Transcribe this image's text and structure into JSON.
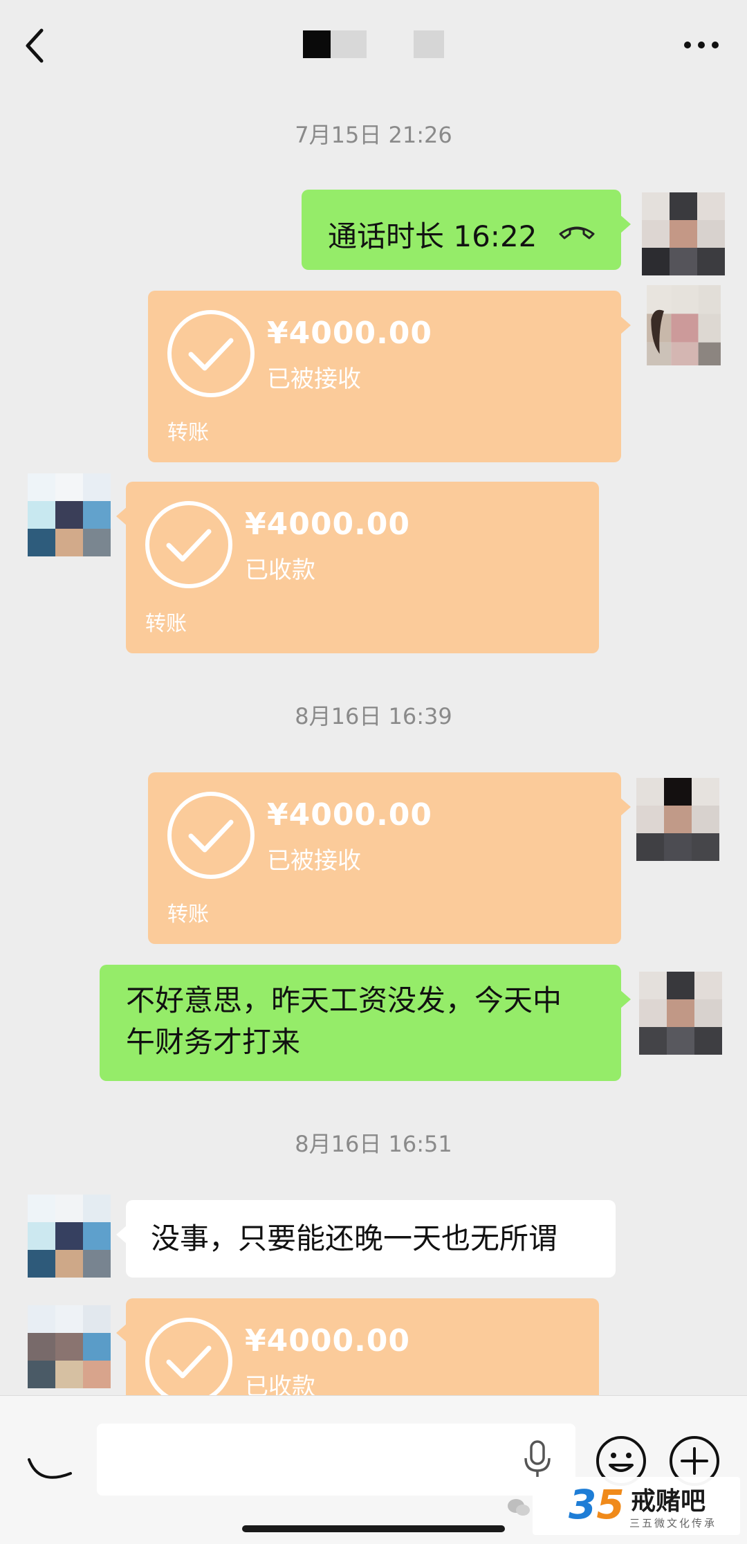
{
  "header": {
    "back_icon": "chevron-left-icon",
    "more_icon": "more-dots-icon"
  },
  "timestamps": [
    "7月15日 21:26",
    "8月16日 16:39",
    "8月16日 16:51"
  ],
  "messages": {
    "call": {
      "label": "通话时长 16:22",
      "icon": "phone-hangup-icon"
    },
    "transfer_1": {
      "amount": "¥4000.00",
      "status": "已被接收",
      "label": "转账"
    },
    "transfer_2": {
      "amount": "¥4000.00",
      "status": "已收款",
      "label": "转账"
    },
    "transfer_3": {
      "amount": "¥4000.00",
      "status": "已被接收",
      "label": "转账"
    },
    "text_1": {
      "line1": "不好意思，昨天工资没发，今天中",
      "line2": "午财务才打来"
    },
    "text_2": {
      "text": "没事，只要能还晚一天也无所谓"
    },
    "transfer_4": {
      "amount": "¥4000.00",
      "status": "已收款"
    }
  },
  "input_bar": {
    "voice_icon": "voice-toggle-icon",
    "mic_icon": "microphone-icon",
    "emoji_icon": "emoji-icon",
    "plus_icon": "plus-icon"
  },
  "watermark": {
    "number_3": "3",
    "number_5": "5",
    "title": "戒赌吧",
    "subtitle": "三五微文化传承"
  },
  "colors": {
    "background": "#ededed",
    "green_bubble": "#95ec69",
    "transfer_card": "#fbcb9a",
    "white_bubble": "#ffffff"
  }
}
